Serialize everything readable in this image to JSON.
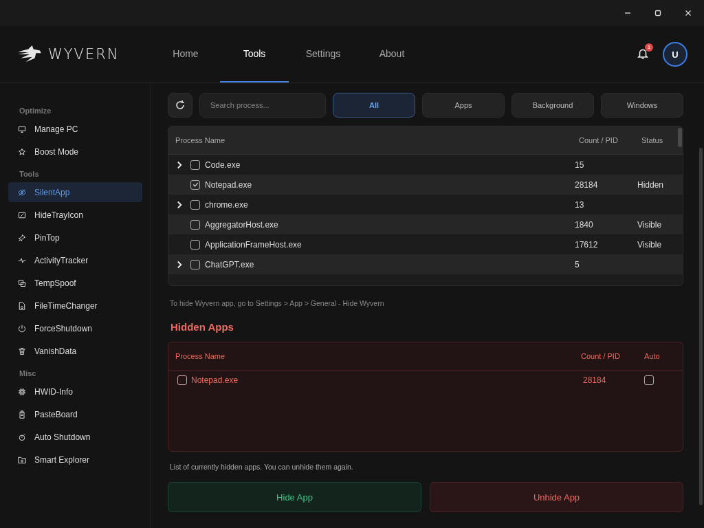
{
  "app": {
    "name": "WYVERN"
  },
  "nav_tabs": [
    {
      "label": "Home",
      "selected": false
    },
    {
      "label": "Tools",
      "selected": true
    },
    {
      "label": "Settings",
      "selected": false
    },
    {
      "label": "About",
      "selected": false
    }
  ],
  "notifications": {
    "count": "1"
  },
  "avatar": {
    "initial": "U"
  },
  "sidebar": {
    "sections": [
      {
        "title": "Optimize",
        "items": [
          {
            "label": "Manage PC",
            "selected": false
          },
          {
            "label": "Boost Mode",
            "selected": false
          }
        ]
      },
      {
        "title": "Tools",
        "items": [
          {
            "label": "SilentApp",
            "selected": true
          },
          {
            "label": "HideTrayIcon",
            "selected": false
          },
          {
            "label": "PinTop",
            "selected": false
          },
          {
            "label": "ActivityTracker",
            "selected": false
          },
          {
            "label": "TempSpoof",
            "selected": false
          },
          {
            "label": "FileTimeChanger",
            "selected": false
          },
          {
            "label": "ForceShutdown",
            "selected": false
          },
          {
            "label": "VanishData",
            "selected": false
          }
        ]
      },
      {
        "title": "Misc",
        "items": [
          {
            "label": "HWID-Info",
            "selected": false
          },
          {
            "label": "PasteBoard",
            "selected": false
          },
          {
            "label": "Auto Shutdown",
            "selected": false
          },
          {
            "label": "Smart Explorer",
            "selected": false
          }
        ]
      }
    ]
  },
  "search": {
    "placeholder": "Search process..."
  },
  "filters": [
    {
      "label": "All",
      "selected": true
    },
    {
      "label": "Apps",
      "selected": false
    },
    {
      "label": "Background",
      "selected": false
    },
    {
      "label": "Windows",
      "selected": false
    }
  ],
  "process_table": {
    "columns": [
      "Process Name",
      "Count / PID",
      "Status"
    ],
    "rows": [
      {
        "name": "Code.exe",
        "count": "15",
        "status": "",
        "expandable": true,
        "checked": false
      },
      {
        "name": "Notepad.exe",
        "count": "28184",
        "status": "Hidden",
        "expandable": false,
        "checked": true
      },
      {
        "name": "chrome.exe",
        "count": "13",
        "status": "",
        "expandable": true,
        "checked": false
      },
      {
        "name": "AggregatorHost.exe",
        "count": "1840",
        "status": "Visible",
        "expandable": false,
        "checked": false
      },
      {
        "name": "ApplicationFrameHost.exe",
        "count": "17612",
        "status": "Visible",
        "expandable": false,
        "checked": false
      },
      {
        "name": "ChatGPT.exe",
        "count": "5",
        "status": "",
        "expandable": true,
        "checked": false
      }
    ]
  },
  "hint": "To hide Wyvern app, go to Settings > App > General - Hide Wyvern",
  "hidden_apps": {
    "title": "Hidden Apps",
    "columns": [
      "Process Name",
      "Count / PID",
      "Auto"
    ],
    "rows": [
      {
        "name": "Notepad.exe",
        "pid": "28184",
        "checked": false,
        "auto": false
      }
    ],
    "caption": "List of currently hidden apps. You can unhide them again."
  },
  "buttons": [
    {
      "label": "Hide App",
      "kind": "hide"
    },
    {
      "label": "Unhide App",
      "kind": "unhide"
    }
  ]
}
